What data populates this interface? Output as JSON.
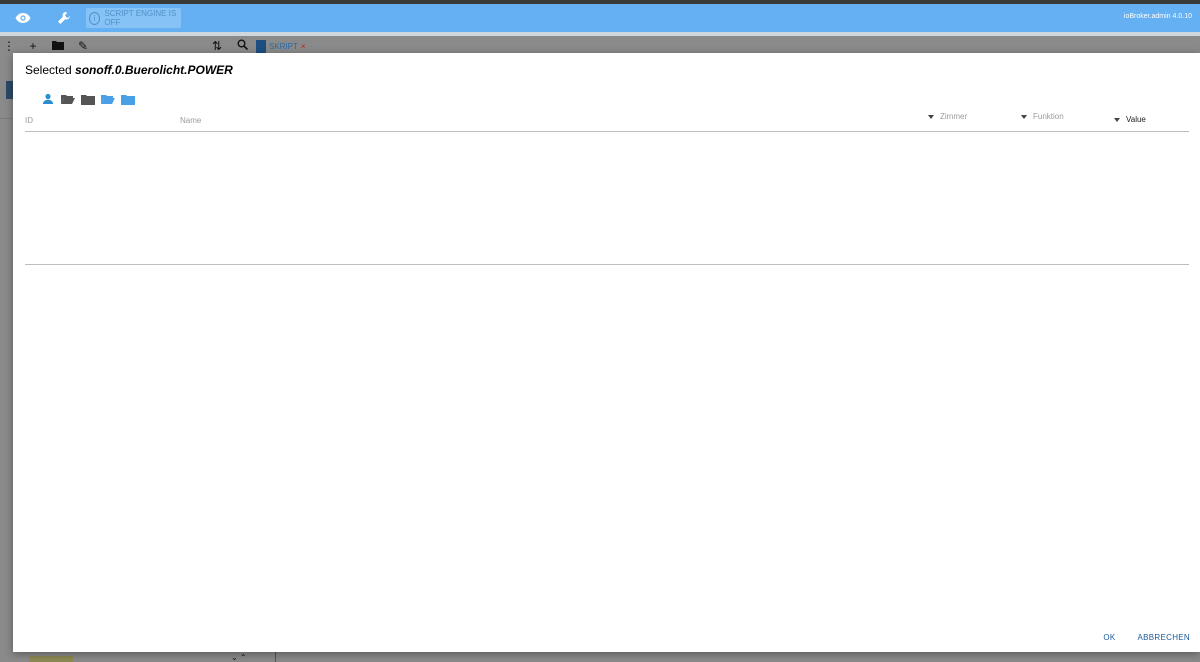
{
  "appbar": {
    "badge_text": "SCRIPT ENGINE IS OFF",
    "version": "ioBroker.admin 4.0.10",
    "icons": [
      "eye-icon",
      "wrench-icon",
      "info-icon"
    ]
  },
  "toolbar": {
    "icons": [
      "more-icon",
      "add-icon",
      "new-folder-icon",
      "edit-icon",
      "sort-icon",
      "search-icon"
    ],
    "tab_label": "SKRIPT"
  },
  "dialog": {
    "title_prefix": "Selected",
    "title_id": "sonoff.0.Buerolicht.POWER",
    "filter_icons": [
      "person-icon",
      "folder-open-icon",
      "folder-icon",
      "folder-open-blue-icon",
      "folder-blue-icon"
    ],
    "columns": {
      "id": "ID",
      "name": "Name",
      "room": "Zimmer",
      "function": "Funktion",
      "value": "Value"
    },
    "ok_label": "OK",
    "cancel_label": "ABBRECHEN"
  },
  "colors": {
    "appbar": "#64b0f2",
    "accent_button": "#1a5a9a"
  }
}
